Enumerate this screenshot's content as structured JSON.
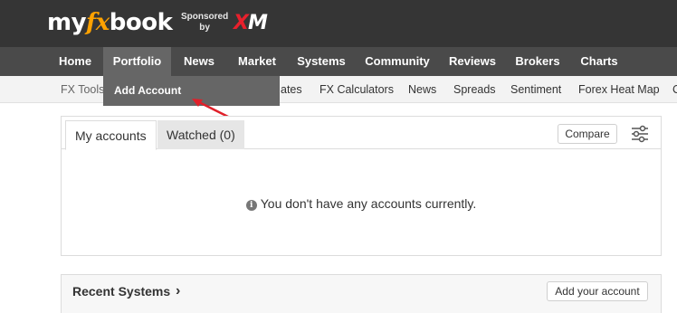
{
  "brand": {
    "logo_prefix": "my",
    "logo_fx": "fx",
    "logo_suffix": "book",
    "sponsored_line1": "Sponsored",
    "sponsored_line2": "by",
    "sponsor_x": "X",
    "sponsor_m": "M",
    "sponsor_color": "#e8202c"
  },
  "main_nav": [
    "Home",
    "Portfolio",
    "News",
    "Market",
    "Systems",
    "Community",
    "Reviews",
    "Brokers",
    "Charts"
  ],
  "sub_nav": {
    "fx_tools": "FX Tools",
    "rates": "ates",
    "items": [
      "FX Calculators",
      "News",
      "Spreads",
      "Sentiment",
      "Forex Heat Map",
      "C"
    ]
  },
  "dropdown": {
    "add_account": "Add Account"
  },
  "accounts_panel": {
    "tab_my_accounts": "My accounts",
    "tab_watched": "Watched (0)",
    "compare_label": "Compare",
    "filter_icon": "sliders-icon",
    "empty_message": "You don't have any accounts currently.",
    "info_icon": "info-icon"
  },
  "recent_systems": {
    "title": "Recent Systems",
    "chevron": "›",
    "add_account_label": "Add your account"
  },
  "colors": {
    "topbar": "#353535",
    "mainnav": "#4a4a4a",
    "active": "#666666",
    "logo_fx": "#ffa200",
    "annotation_arrow": "#e0202a"
  }
}
